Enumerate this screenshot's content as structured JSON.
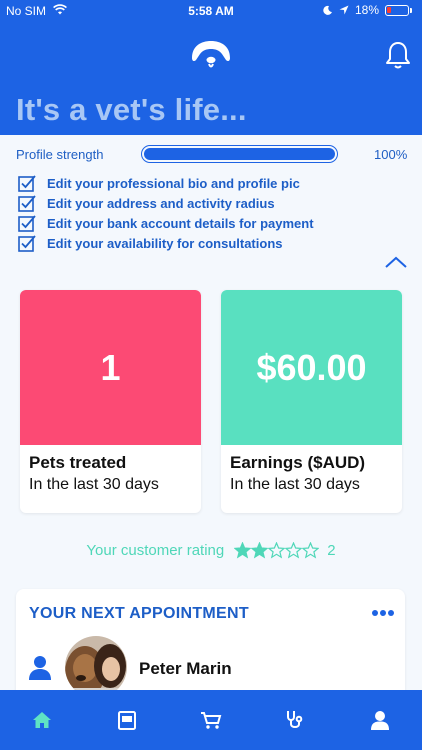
{
  "status_bar": {
    "carrier": "No SIM",
    "time": "5:58 AM",
    "battery": "18%"
  },
  "header": {
    "title": "It's a vet's life..."
  },
  "profile": {
    "strength_label": "Profile strength",
    "strength_percent_text": "100%",
    "strength_value": 1.0,
    "checklist": [
      {
        "label": "Edit your professional bio and profile pic",
        "checked": true
      },
      {
        "label": "Edit your address and activity radius",
        "checked": true
      },
      {
        "label": "Edit your bank account details for payment",
        "checked": true
      },
      {
        "label": "Edit your availability for consultations",
        "checked": true
      }
    ]
  },
  "cards": [
    {
      "value": "1",
      "title": "Pets treated",
      "subtitle": "In the last 30 days",
      "color": "#fc4a74"
    },
    {
      "value": "$60.00",
      "title": "Earnings ($AUD)",
      "subtitle": "In the last 30 days",
      "color": "#59e0c0"
    }
  ],
  "rating": {
    "label": "Your customer rating",
    "stars": 2,
    "max_stars": 5,
    "count": "2",
    "color": "#4fd7b8"
  },
  "appointment": {
    "title": "YOUR NEXT APPOINTMENT",
    "name": "Peter Marin"
  },
  "tabs": [
    {
      "icon": "home-icon",
      "active": true
    },
    {
      "icon": "calendar-icon",
      "active": false
    },
    {
      "icon": "cart-icon",
      "active": false
    },
    {
      "icon": "stethoscope-icon",
      "active": false
    },
    {
      "icon": "person-icon",
      "active": false
    }
  ],
  "colors": {
    "brand": "#1d63e4",
    "text_blue": "#1d5ec7",
    "active_tab": "#5fe3c4"
  }
}
